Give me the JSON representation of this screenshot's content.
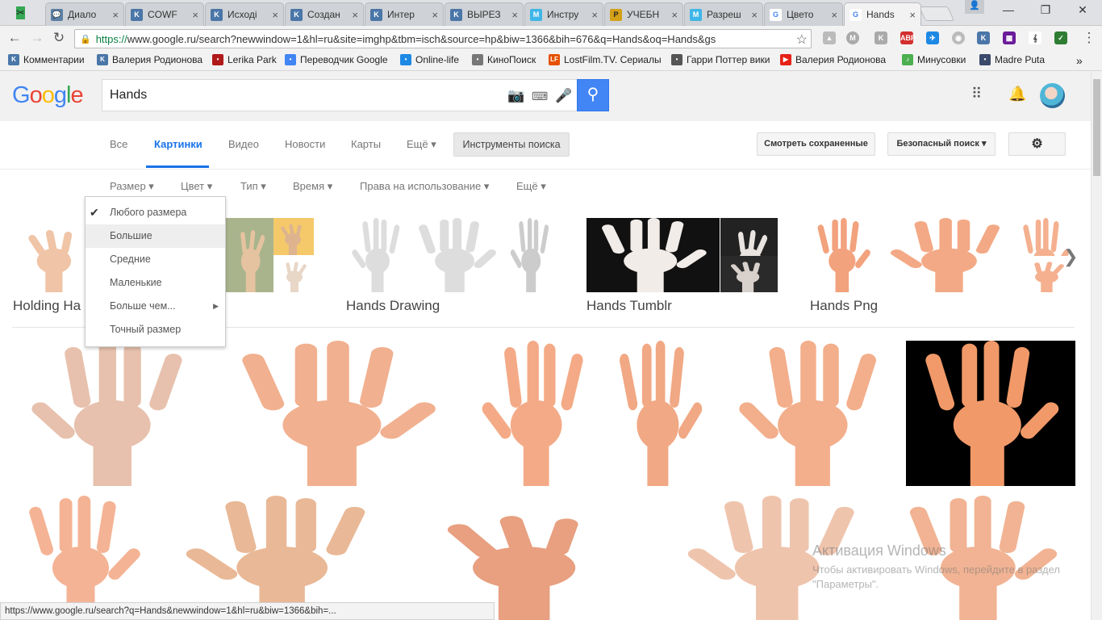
{
  "browser": {
    "tabs": [
      {
        "label": "Диало",
        "favicon": "chat-icon",
        "color": "#5b7fa6"
      },
      {
        "label": "COWF",
        "favicon": "vk-icon",
        "color": "#4a76a8"
      },
      {
        "label": "Исході",
        "favicon": "vk-icon",
        "color": "#4a76a8"
      },
      {
        "label": "Создан",
        "favicon": "vk-icon",
        "color": "#4a76a8"
      },
      {
        "label": "Интер",
        "favicon": "vk-icon",
        "color": "#4a76a8"
      },
      {
        "label": "ВЫРЕЗ",
        "favicon": "vk-icon",
        "color": "#4a76a8"
      },
      {
        "label": "Инстру",
        "favicon": "fm-icon",
        "color": "#3fb6e8"
      },
      {
        "label": "УЧЕБН",
        "favicon": "p-icon",
        "color": "#d4a017"
      },
      {
        "label": "Разреш",
        "favicon": "fm-icon",
        "color": "#3fb6e8"
      },
      {
        "label": "Цвето",
        "favicon": "google-g-icon",
        "color": "#ffffff"
      },
      {
        "label": "Hands",
        "favicon": "google-g-icon",
        "color": "#ffffff"
      }
    ],
    "tab_close_glyph": "×",
    "window_controls": {
      "minimize": "—",
      "restore": "❐",
      "close": "✕"
    },
    "url_scheme": "https://",
    "url_rest": "www.google.ru/search?newwindow=1&hl=ru&site=imghp&tbm=isch&source=hp&biw=1366&bih=676&q=Hands&oq=Hands&gs",
    "bookmarks": [
      {
        "label": "Комментарии",
        "icon": "vk-icon",
        "color": "#4a76a8"
      },
      {
        "label": "Валерия Родионова",
        "icon": "vk-icon",
        "color": "#4a76a8"
      },
      {
        "label": "Lerika Park",
        "icon": "feather-icon",
        "color": "#b11a1a"
      },
      {
        "label": "Переводчик Google",
        "icon": "translate-icon",
        "color": "#4285f4"
      },
      {
        "label": "Online-life",
        "icon": "bird-icon",
        "color": "#1e88e5"
      },
      {
        "label": "КиноПоиск",
        "icon": "film-reel-icon",
        "color": "#777777"
      },
      {
        "label": "LostFilm.TV. Сериалы",
        "icon": "lf-icon",
        "color": "#e65100"
      },
      {
        "label": "Гарри Поттер вики",
        "icon": "wiki-icon",
        "color": "#555555"
      },
      {
        "label": "Валерия Родионова",
        "icon": "youtube-icon",
        "color": "#e62117"
      },
      {
        "label": "Минусовки",
        "icon": "music-note-icon",
        "color": "#4caf50"
      },
      {
        "label": "Madre Puta",
        "icon": "person-icon",
        "color": "#3b4a6b"
      }
    ],
    "bookmarks_overflow": "»",
    "status_url": "https://www.google.ru/search?q=Hands&newwindow=1&hl=ru&biw=1366&bih=..."
  },
  "google": {
    "logo_letters": [
      {
        "ch": "G",
        "color": "#4285f4"
      },
      {
        "ch": "o",
        "color": "#ea4335"
      },
      {
        "ch": "o",
        "color": "#fbbc05"
      },
      {
        "ch": "g",
        "color": "#4285f4"
      },
      {
        "ch": "l",
        "color": "#34a853"
      },
      {
        "ch": "e",
        "color": "#ea4335"
      }
    ],
    "query": "Hands",
    "tabs": [
      {
        "label": "Все",
        "active": false
      },
      {
        "label": "Картинки",
        "active": true
      },
      {
        "label": "Видео",
        "active": false
      },
      {
        "label": "Новости",
        "active": false
      },
      {
        "label": "Карты",
        "active": false
      },
      {
        "label": "Ещё ▾",
        "active": false
      }
    ],
    "tools_label": "Инструменты поиска",
    "saved_label": "Смотреть сохраненные",
    "safesearch_label": "Безопасный поиск ▾",
    "filters": [
      "Размер ▾",
      "Цвет ▾",
      "Тип ▾",
      "Время ▾",
      "Права на использование ▾",
      "Ещё ▾"
    ],
    "size_menu": [
      {
        "label": "Любого размера",
        "checked": true,
        "submenu": false
      },
      {
        "label": "Большие",
        "checked": false,
        "submenu": false
      },
      {
        "label": "Средние",
        "checked": false,
        "submenu": false
      },
      {
        "label": "Маленькие",
        "checked": false,
        "submenu": false
      },
      {
        "label": "Больше чем...",
        "checked": false,
        "submenu": true
      },
      {
        "label": "Точный размер",
        "checked": false,
        "submenu": false
      }
    ],
    "suggestions": [
      "Holding Ha",
      "Hands Drawing",
      "Hands Tumblr",
      "Hands Png"
    ],
    "watermark_title": "Активация Windows",
    "watermark_body": "Чтобы активировать Windows, перейдите в раздел \"Параметры\"."
  }
}
